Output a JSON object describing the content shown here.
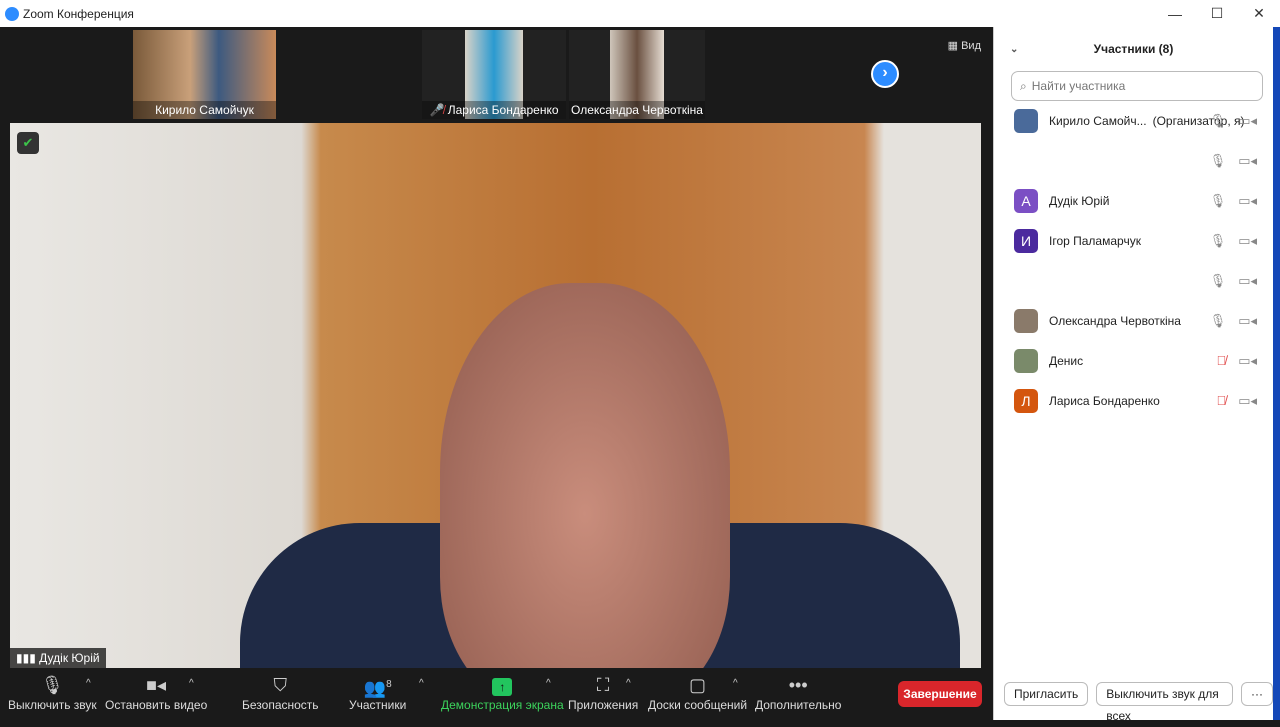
{
  "window": {
    "title": "Zoom Конференция",
    "minimize": "—",
    "maximize": "☐",
    "close": "✕"
  },
  "stage": {
    "view_label": "Вид",
    "next": "›",
    "thumbnails": [
      {
        "name": "Кирило Самойчук",
        "muted": false
      },
      {
        "name": "Лариса Бондаренко",
        "muted": true
      },
      {
        "name": "Олександра Червоткіна",
        "muted": false
      }
    ],
    "active_speaker": "Дудік Юрій"
  },
  "toolbar": {
    "mute": "Выключить звук",
    "video": "Остановить видео",
    "security": "Безопасность",
    "participants": "Участники",
    "participants_count": "8",
    "share": "Демонстрация экрана",
    "apps": "Приложения",
    "whiteboards": "Доски сообщений",
    "more": "Дополнительно",
    "end": "Завершение"
  },
  "panel": {
    "title": "Участники (8)",
    "search_placeholder": "Найти участника",
    "participants": [
      {
        "name": "Кирило Самойч...",
        "role": "(Организатор, я)",
        "initial": "",
        "color": "#4a6a9a",
        "muted": false
      },
      {
        "name": "",
        "role": "",
        "initial": "",
        "color": "",
        "muted": false
      },
      {
        "name": "Дудік Юрій",
        "role": "",
        "initial": "А",
        "color": "#7b4fc4",
        "muted": false
      },
      {
        "name": "Ігор Паламарчук",
        "role": "",
        "initial": "И",
        "color": "#4b2a9e",
        "muted": false
      },
      {
        "name": "",
        "role": "",
        "initial": "",
        "color": "",
        "muted": false
      },
      {
        "name": "Олександра Червоткіна",
        "role": "",
        "initial": "",
        "color": "#8a7a6a",
        "muted": false
      },
      {
        "name": "Денис",
        "role": "",
        "initial": "",
        "color": "#7a8a6a",
        "muted": true
      },
      {
        "name": "Лариса Бондаренко",
        "role": "",
        "initial": "Л",
        "color": "#d4560e",
        "muted": true
      }
    ],
    "invite": "Пригласить",
    "mute_all": "Выключить звук для всех",
    "more": "···"
  }
}
